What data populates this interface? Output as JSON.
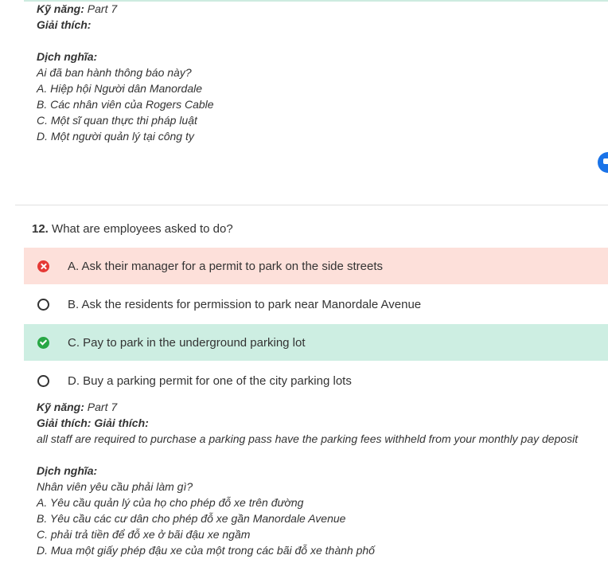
{
  "top_explanation": {
    "skill_label": "Kỹ năng:",
    "skill_value": "Part 7",
    "explain_label": "Giải thích:",
    "translation_label": "Dịch nghĩa:",
    "question": "Ai đã ban hành thông báo này?",
    "options": [
      "A. Hiệp hội Người dân Manordale",
      "B. Các nhân viên của Rogers Cable",
      "C. Một sĩ quan thực thi pháp luật",
      "D. Một người quản lý tại công ty"
    ]
  },
  "question": {
    "number": "12.",
    "text": "What are employees asked to do?",
    "options": [
      {
        "label": "A. Ask their manager for a permit to park on the side streets",
        "state": "wrong"
      },
      {
        "label": "B. Ask the residents for permission to park near Manordale Avenue",
        "state": "unselected"
      },
      {
        "label": "C. Pay to park in the underground parking lot",
        "state": "correct"
      },
      {
        "label": "D. Buy a parking permit for one of the city parking lots",
        "state": "unselected"
      }
    ]
  },
  "explanation": {
    "skill_label": "Kỹ năng:",
    "skill_value": "Part 7",
    "explain_label": "Giải thích: Giải thích:",
    "explain_text": "all staff are required to purchase a parking pass have the parking fees withheld from your monthly pay deposit",
    "translation_label": "Dịch nghĩa:",
    "question": "Nhân viên yêu cầu phải làm gì?",
    "options": [
      "A. Yêu cầu quản lý của họ cho phép đỗ xe trên đường",
      "B. Yêu cầu các cư dân cho phép đỗ xe gần Manordale Avenue",
      "C. phải trả tiền để đỗ xe ở bãi đậu xe ngầm",
      "D. Mua một giấy phép đậu xe của một trong các bãi đỗ xe thành phố"
    ]
  },
  "colors": {
    "wrong_bg": "#fde0da",
    "correct_bg": "#cdeee2",
    "wrong_icon": "#e53935",
    "correct_icon": "#28a745",
    "accent": "#1a73e8"
  }
}
